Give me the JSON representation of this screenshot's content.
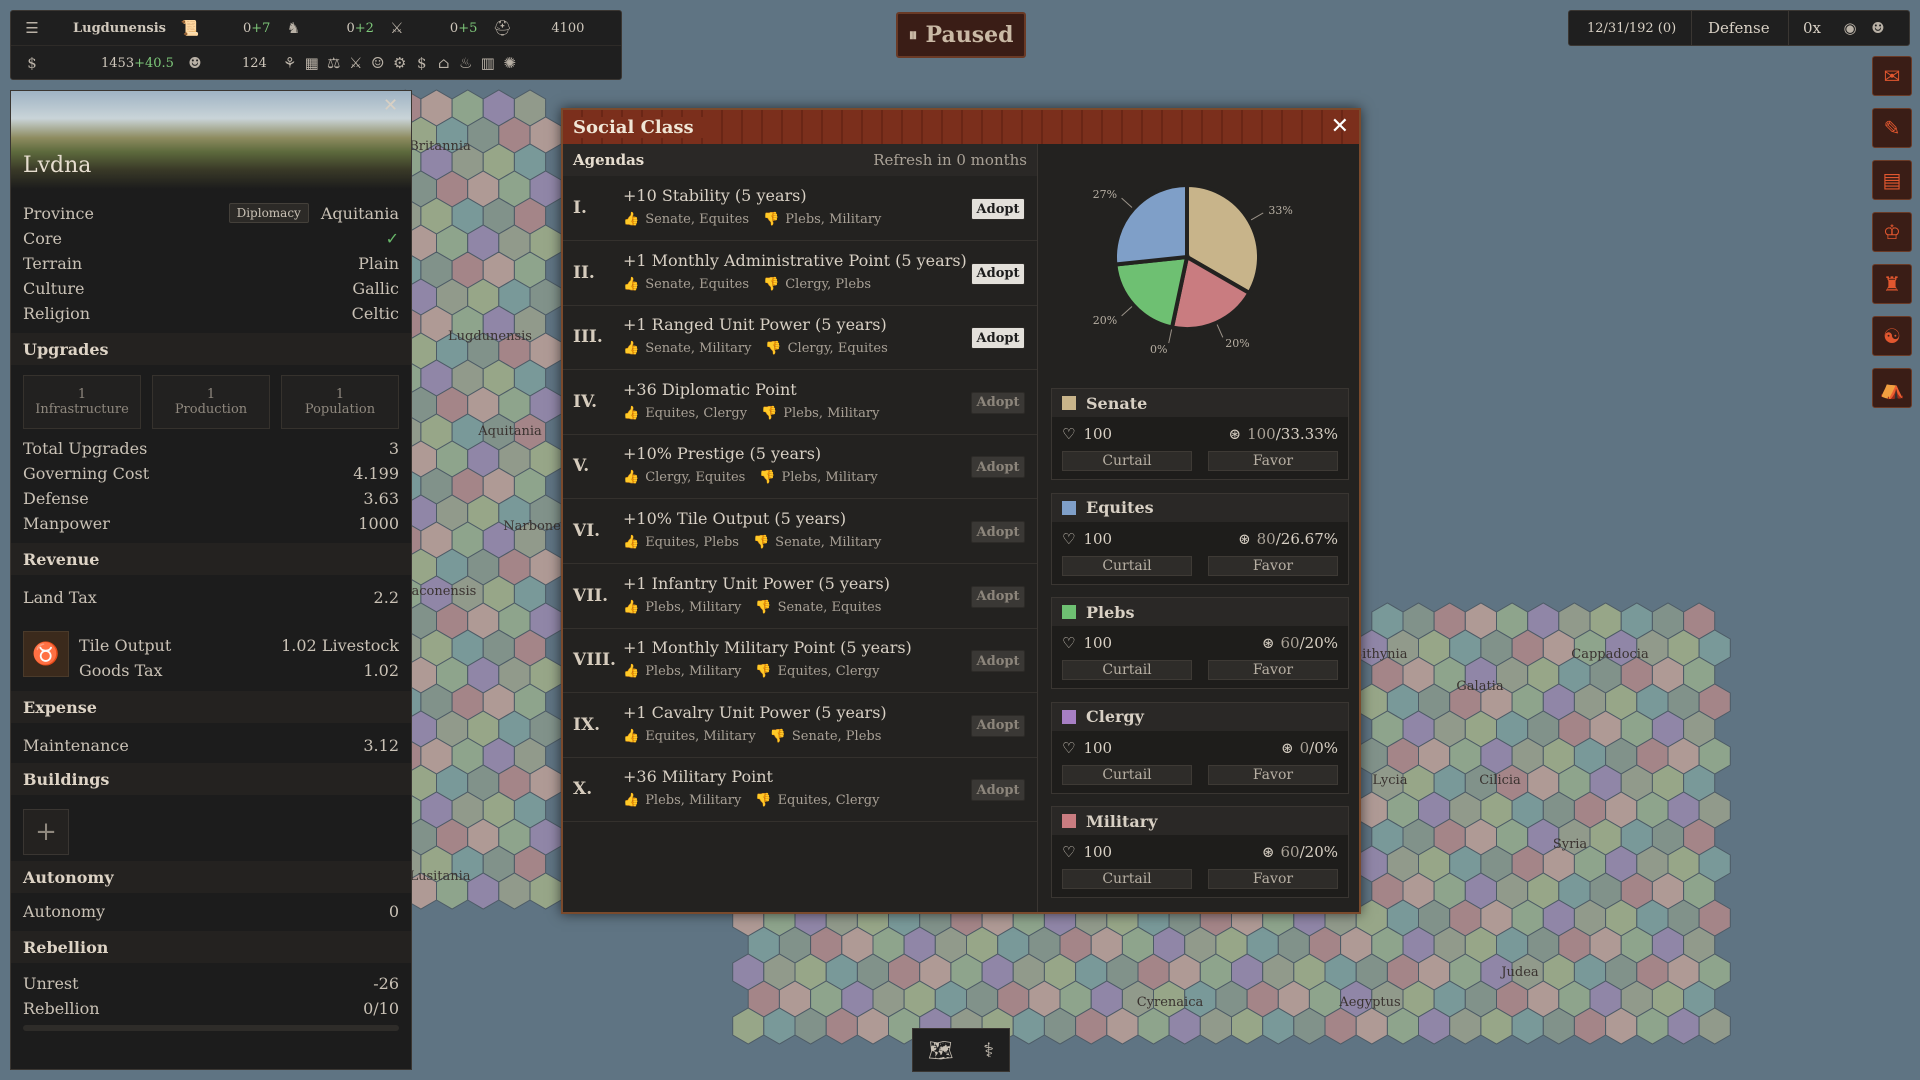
{
  "topbar": {
    "menu_icon": "menu-icon",
    "province": "Lugdunensis",
    "row1": [
      {
        "icon": "scroll-icon",
        "value": "0",
        "delta": "+7"
      },
      {
        "icon": "horse-icon",
        "value": "0",
        "delta": "+2"
      },
      {
        "icon": "swords-icon",
        "value": "0",
        "delta": "+5"
      },
      {
        "icon": "helmet-icon",
        "value": "4100",
        "delta": ""
      }
    ],
    "gold": "1453",
    "gold_delta": "+40.5",
    "population": "124"
  },
  "paused": {
    "label": "Paused"
  },
  "topright": {
    "date": "12/31/192 (0)",
    "mode": "Defense",
    "speed": "0x"
  },
  "left": {
    "title": "Lvdna",
    "province_label": "Province",
    "diplomacy_badge": "Diplomacy",
    "province_value": "Aquitania",
    "core_label": "Core",
    "terrain_label": "Terrain",
    "terrain_value": "Plain",
    "culture_label": "Culture",
    "culture_value": "Gallic",
    "religion_label": "Religion",
    "religion_value": "Celtic",
    "upgrades_header": "Upgrades",
    "upgrades": [
      {
        "count": "1",
        "label": "Infrastructure"
      },
      {
        "count": "1",
        "label": "Production"
      },
      {
        "count": "1",
        "label": "Population"
      }
    ],
    "total_upgrades_label": "Total Upgrades",
    "total_upgrades_value": "3",
    "governing_label": "Governing Cost",
    "governing_value": "4.199",
    "defense_label": "Defense",
    "defense_value": "3.63",
    "manpower_label": "Manpower",
    "manpower_value": "1000",
    "revenue_header": "Revenue",
    "land_tax_label": "Land Tax",
    "land_tax_value": "2.2",
    "tile_output_label": "Tile Output",
    "tile_output_value": "1.02 Livestock",
    "goods_tax_label": "Goods Tax",
    "goods_tax_value": "1.02",
    "expense_header": "Expense",
    "maintenance_label": "Maintenance",
    "maintenance_value": "3.12",
    "buildings_header": "Buildings",
    "autonomy_header": "Autonomy",
    "autonomy_label": "Autonomy",
    "autonomy_value": "0",
    "rebellion_header": "Rebellion",
    "unrest_label": "Unrest",
    "unrest_value": "-26",
    "rebellion_label": "Rebellion",
    "rebellion_value": "0/10"
  },
  "dialog": {
    "title": "Social Class",
    "agendas_label": "Agendas",
    "refresh_label": "Refresh in 0 months",
    "agendas": [
      {
        "num": "I.",
        "title": "+10 Stability (5 years)",
        "pro": "Senate, Equites",
        "con": "Plebs, Military",
        "button": "Adopt",
        "enabled": true
      },
      {
        "num": "II.",
        "title": "+1 Monthly Administrative Point (5 years)",
        "pro": "Senate, Equites",
        "con": "Clergy, Plebs",
        "button": "Adopt",
        "enabled": true
      },
      {
        "num": "III.",
        "title": "+1 Ranged Unit Power (5 years)",
        "pro": "Senate, Military",
        "con": "Clergy, Equites",
        "button": "Adopt",
        "enabled": true
      },
      {
        "num": "IV.",
        "title": "+36 Diplomatic Point",
        "pro": "Equites, Clergy",
        "con": "Plebs, Military",
        "button": "Adopt",
        "enabled": false
      },
      {
        "num": "V.",
        "title": "+10% Prestige (5 years)",
        "pro": "Clergy, Equites",
        "con": "Plebs, Military",
        "button": "Adopt",
        "enabled": false
      },
      {
        "num": "VI.",
        "title": "+10% Tile Output (5 years)",
        "pro": "Equites, Plebs",
        "con": "Senate, Military",
        "button": "Adopt",
        "enabled": false
      },
      {
        "num": "VII.",
        "title": "+1 Infantry Unit Power (5 years)",
        "pro": "Plebs, Military",
        "con": "Senate, Equites",
        "button": "Adopt",
        "enabled": false
      },
      {
        "num": "VIII.",
        "title": "+1 Monthly Military Point (5 years)",
        "pro": "Plebs, Military",
        "con": "Equites, Clergy",
        "button": "Adopt",
        "enabled": false
      },
      {
        "num": "IX.",
        "title": "+1 Cavalry Unit Power (5 years)",
        "pro": "Equites, Military",
        "con": "Senate, Plebs",
        "button": "Adopt",
        "enabled": false
      },
      {
        "num": "X.",
        "title": "+36 Military Point",
        "pro": "Plebs, Military",
        "con": "Equites, Clergy",
        "button": "Adopt",
        "enabled": false
      }
    ],
    "classes": [
      {
        "name": "Senate",
        "color": "#c8b48a",
        "loyalty": "100",
        "influence": "100",
        "share": "33.33%",
        "curtail": "Curtail",
        "favor": "Favor"
      },
      {
        "name": "Equites",
        "color": "#7f9fc8",
        "loyalty": "100",
        "influence": "80",
        "share": "26.67%",
        "curtail": "Curtail",
        "favor": "Favor"
      },
      {
        "name": "Plebs",
        "color": "#6ec072",
        "loyalty": "100",
        "influence": "60",
        "share": "20%",
        "curtail": "Curtail",
        "favor": "Favor"
      },
      {
        "name": "Clergy",
        "color": "#a77fc4",
        "loyalty": "100",
        "influence": "0",
        "share": "0%",
        "curtail": "Curtail",
        "favor": "Favor"
      },
      {
        "name": "Military",
        "color": "#c97c80",
        "loyalty": "100",
        "influence": "60",
        "share": "20%",
        "curtail": "Curtail",
        "favor": "Favor"
      }
    ]
  },
  "chart_data": {
    "type": "pie",
    "categories": [
      "Senate",
      "Military",
      "Clergy",
      "Plebs",
      "Equites"
    ],
    "values": [
      33.33,
      20,
      0,
      20,
      26.67
    ],
    "labels": [
      "33%",
      "20%",
      "0%",
      "20%",
      "27%"
    ],
    "colors": [
      "#c8b48a",
      "#c97c80",
      "#a77fc4",
      "#6ec072",
      "#7f9fc8"
    ]
  },
  "map_labels": [
    "Britannia",
    "Lugdunensis",
    "Aquitania",
    "Narbonensis",
    "Tarraconensis",
    "Lusitania",
    "Bithynia",
    "Galatia",
    "Cappadocia",
    "Lycia",
    "Cilicia",
    "Syria",
    "Judea",
    "Cyrenaica",
    "Aegyptus"
  ],
  "bottom": {
    "map_icon": "map-icon",
    "tree_icon": "tree-icon"
  }
}
